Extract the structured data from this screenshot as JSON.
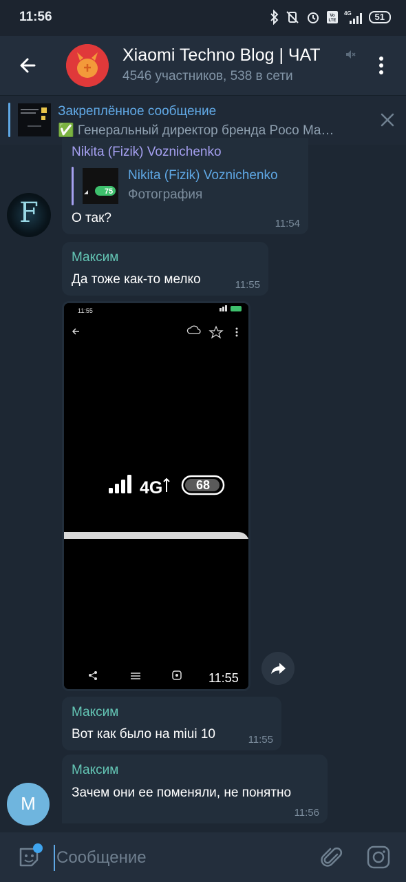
{
  "status": {
    "time": "11:56",
    "battery": "51",
    "network": "4G"
  },
  "chat": {
    "title": "Xiaomi Techno Blog | ЧАТ",
    "subtitle": "4546 участников, 538 в сети"
  },
  "pinned": {
    "title": "Закреплённое сообщение",
    "text": "✅ Генеральный директор бренда Poco Ma…"
  },
  "messages": [
    {
      "sender": "Nikita (Fizik) Voznichenko",
      "reply": {
        "sender": "Nikita (Fizik) Voznichenko",
        "text": "Фотография",
        "thumb_value": "75"
      },
      "text": "О так?",
      "time": "11:54"
    },
    {
      "sender": "Максим",
      "text": "Да тоже как-то мелко",
      "time": "11:55"
    },
    {
      "type": "photo",
      "photo": {
        "status_time": "11:55",
        "signal_label": "4G",
        "battery": "68",
        "overlay_time": "11:55"
      }
    },
    {
      "sender": "Максим",
      "text": "Вот как было на miui 10",
      "time": "11:55"
    },
    {
      "sender": "Максим",
      "text": "Зачем они ее поменяли, не понятно",
      "time": "11:56"
    }
  ],
  "avatars": {
    "f_initial": "F",
    "m_initial": "M"
  },
  "input": {
    "placeholder": "Сообщение"
  },
  "colors": {
    "accent": "#5fa8e5",
    "sender_name": "#64c6b5",
    "sender_name_alt": "#a5a0f0",
    "background": "#1d2733",
    "bubble": "#222e3b"
  }
}
